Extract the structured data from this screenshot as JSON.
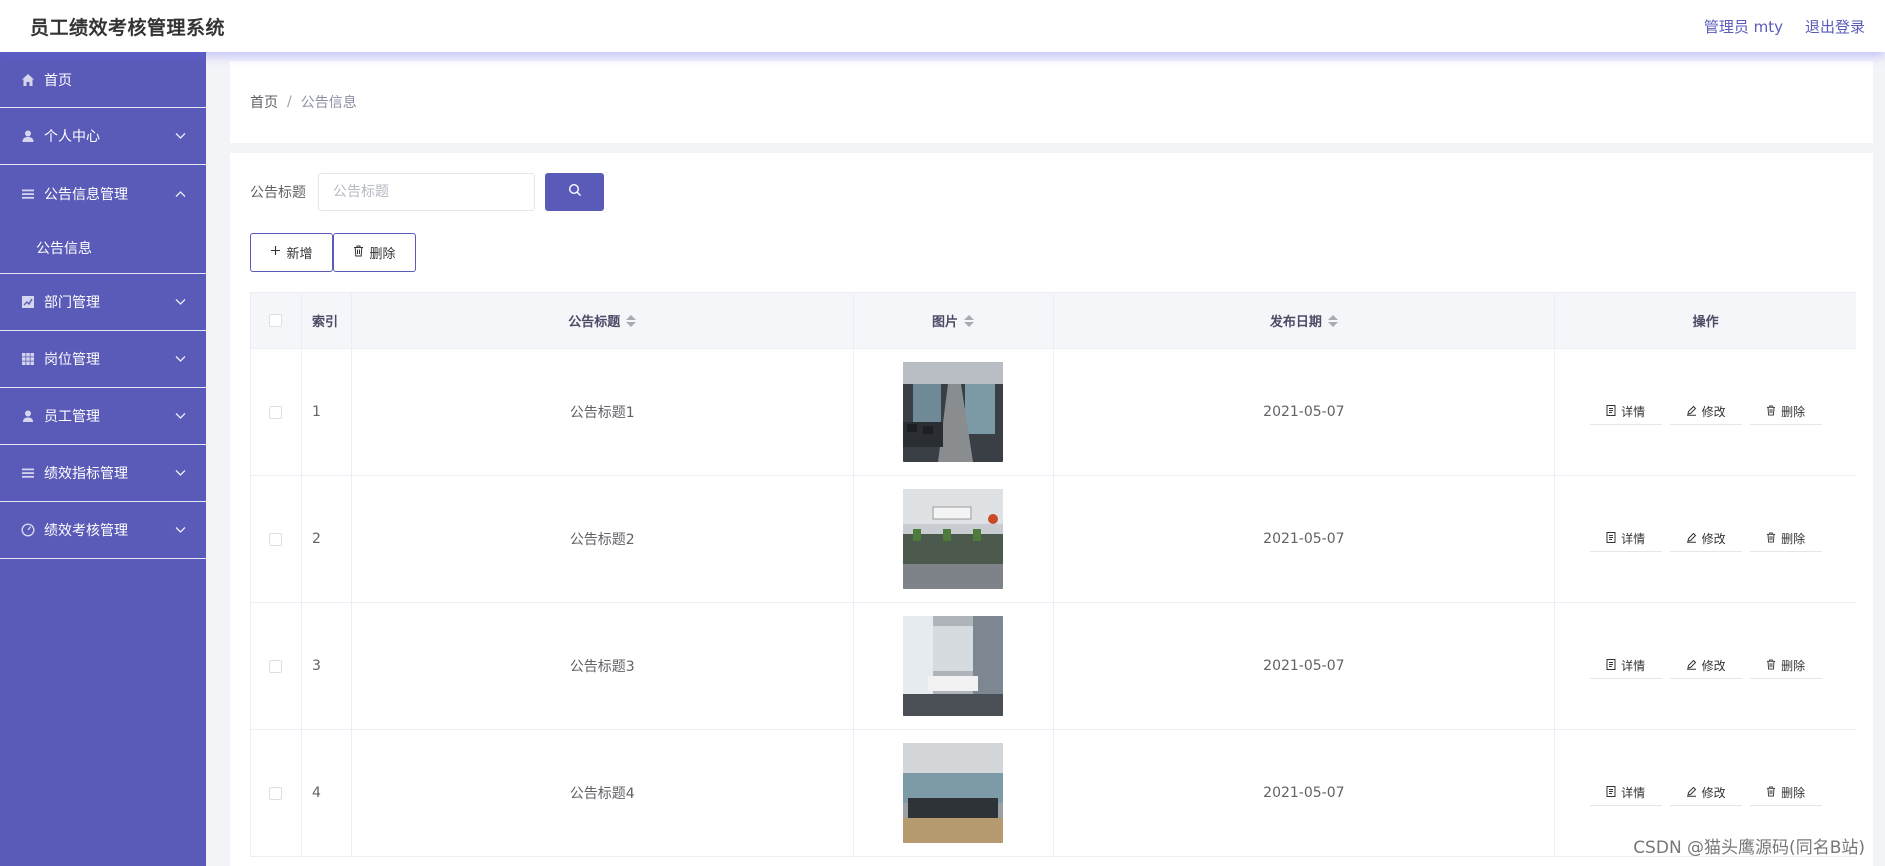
{
  "header": {
    "app_title": "员工绩效考核管理系统",
    "user_label": "管理员 mty",
    "logout_label": "退出登录"
  },
  "sidebar": {
    "items": [
      {
        "label": "首页",
        "icon": "home-icon"
      },
      {
        "label": "个人中心",
        "icon": "user-icon",
        "expanded": false
      },
      {
        "label": "公告信息管理",
        "icon": "list-icon",
        "expanded": true,
        "children": [
          {
            "label": "公告信息"
          }
        ]
      },
      {
        "label": "部门管理",
        "icon": "chart-icon",
        "expanded": false
      },
      {
        "label": "岗位管理",
        "icon": "grid-icon",
        "expanded": false
      },
      {
        "label": "员工管理",
        "icon": "person-icon",
        "expanded": false
      },
      {
        "label": "绩效指标管理",
        "icon": "list-icon",
        "expanded": false
      },
      {
        "label": "绩效考核管理",
        "icon": "gauge-icon",
        "expanded": false
      }
    ],
    "accent_color": "#5a5ab8"
  },
  "breadcrumb": {
    "home": "首页",
    "separator": "/",
    "current": "公告信息"
  },
  "search": {
    "label": "公告标题",
    "placeholder": "公告标题",
    "value": ""
  },
  "actions": {
    "add_label": "新增",
    "delete_label": "删除"
  },
  "table": {
    "columns": {
      "index": "索引",
      "title": "公告标题",
      "image": "图片",
      "date": "发布日期",
      "ops": "操作"
    },
    "ops_labels": {
      "detail": "详情",
      "edit": "修改",
      "delete": "删除"
    },
    "rows": [
      {
        "index": "1",
        "title": "公告标题1",
        "date": "2021-05-07"
      },
      {
        "index": "2",
        "title": "公告标题2",
        "date": "2021-05-07"
      },
      {
        "index": "3",
        "title": "公告标题3",
        "date": "2021-05-07"
      },
      {
        "index": "4",
        "title": "公告标题4",
        "date": "2021-05-07"
      }
    ]
  },
  "watermark": "CSDN @猫头鹰源码(同名B站)"
}
